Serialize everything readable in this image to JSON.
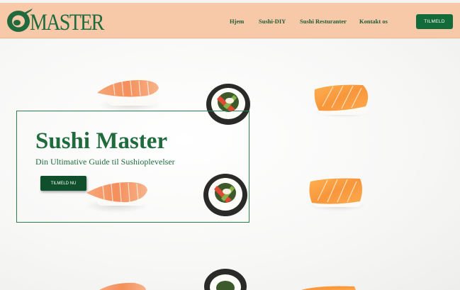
{
  "header": {
    "logo_text": "MASTER",
    "nav": [
      {
        "label": "Hjem"
      },
      {
        "label": "Sushi-DIY"
      },
      {
        "label": "Sushi Resturanter"
      },
      {
        "label": "Kontakt os"
      }
    ],
    "signup_label": "TILMELD"
  },
  "hero": {
    "title": "Sushi Master",
    "subtitle": "Din Ultimative Guide til Sushioplevelser",
    "cta_label": "TILMELD NU"
  },
  "colors": {
    "header_bg": "#f7c9a8",
    "brand_green": "#1f6b3e",
    "button_green": "#146b3a"
  }
}
